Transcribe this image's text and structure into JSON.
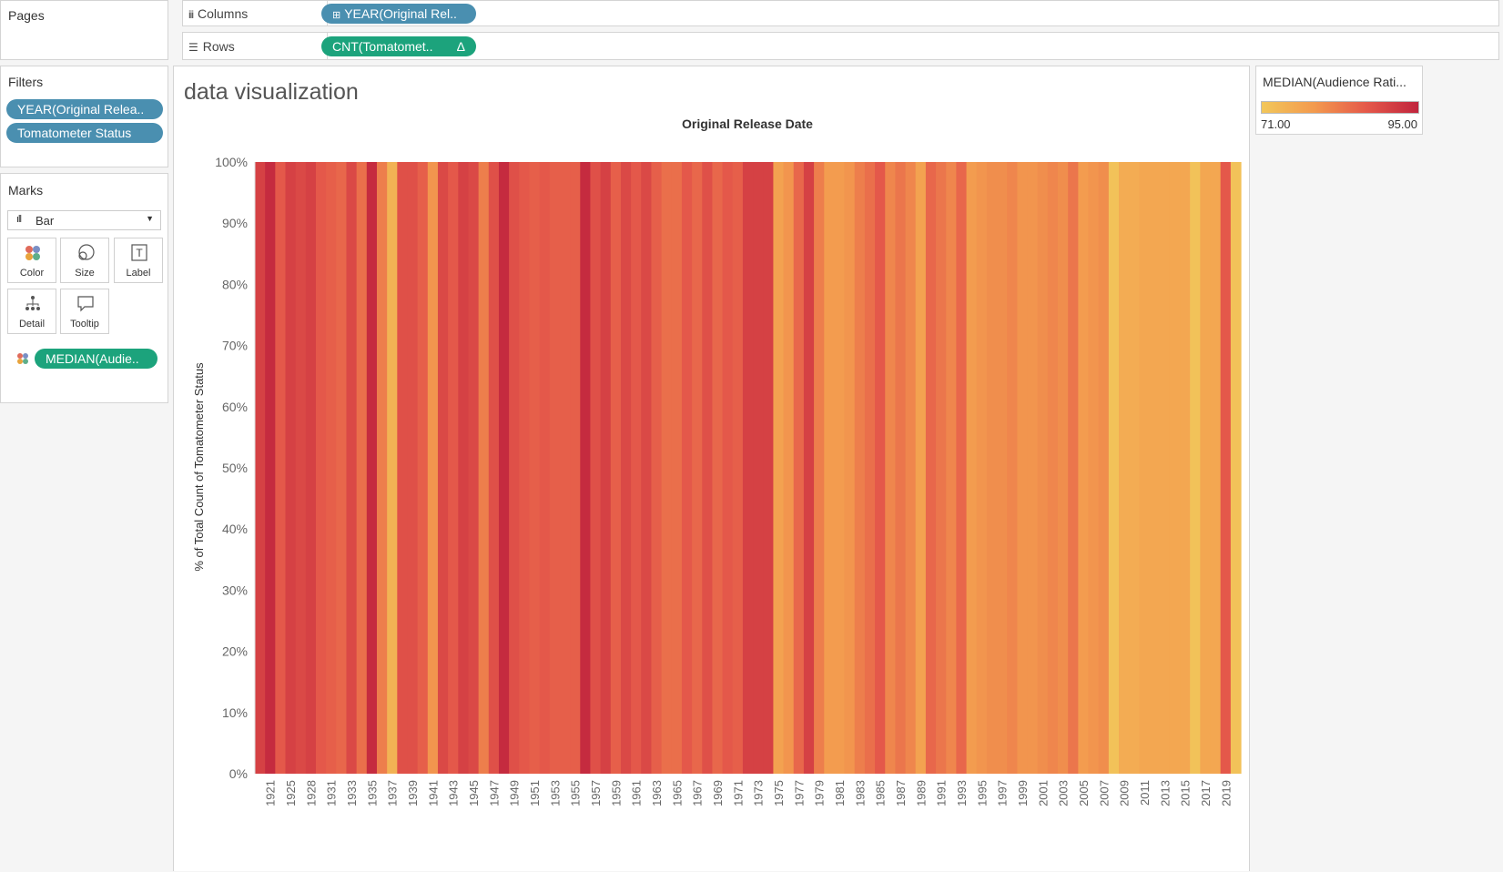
{
  "pages_panel": {
    "title": "Pages"
  },
  "columns_shelf": {
    "label": "Columns",
    "pill": "YEAR(Original Rel.."
  },
  "rows_shelf": {
    "label": "Rows",
    "pill": "CNT(Tomatomet..",
    "pill_delta": "Δ"
  },
  "filters_panel": {
    "title": "Filters",
    "pills": [
      "YEAR(Original Relea..",
      "Tomatometer Status"
    ]
  },
  "marks_panel": {
    "title": "Marks",
    "mark_type": "Bar",
    "buttons": [
      "Color",
      "Size",
      "Label",
      "Detail",
      "Tooltip"
    ],
    "color_pill": "MEDIAN(Audie.."
  },
  "legend": {
    "title": "MEDIAN(Audience Rati...",
    "min_label": "71.00",
    "max_label": "95.00",
    "color_min": "#f2c75a",
    "color_max": "#c0243d"
  },
  "worksheet": {
    "title": "data visualization"
  },
  "chart_data": {
    "type": "bar",
    "title": "Original Release Date",
    "ylabel": "% of Total Count of Tomatometer Status",
    "y_ticks": [
      "100%",
      "90%",
      "80%",
      "70%",
      "60%",
      "50%",
      "40%",
      "30%",
      "20%",
      "10%",
      "0%"
    ],
    "ylim": [
      0,
      100
    ],
    "x_tick_labels": [
      "1921",
      "1925",
      "1928",
      "1931",
      "1933",
      "1935",
      "1937",
      "1939",
      "1941",
      "1943",
      "1945",
      "1947",
      "1949",
      "1951",
      "1953",
      "1955",
      "1957",
      "1959",
      "1961",
      "1963",
      "1965",
      "1967",
      "1969",
      "1971",
      "1973",
      "1975",
      "1977",
      "1979",
      "1981",
      "1983",
      "1985",
      "1987",
      "1989",
      "1991",
      "1993",
      "1995",
      "1997",
      "1999",
      "2001",
      "2003",
      "2005",
      "2007",
      "2009",
      "2011",
      "2013",
      "2015",
      "2017",
      "2019"
    ],
    "categories": [
      "1920",
      "1921",
      "1924",
      "1925",
      "1927",
      "1928",
      "1930",
      "1931",
      "1932",
      "1933",
      "1934",
      "1935",
      "1936",
      "1937",
      "1938",
      "1939",
      "1940",
      "1941",
      "1942",
      "1943",
      "1944",
      "1945",
      "1946",
      "1947",
      "1948",
      "1949",
      "1950",
      "1951",
      "1952",
      "1953",
      "1954",
      "1955",
      "1956",
      "1957",
      "1958",
      "1959",
      "1960",
      "1961",
      "1962",
      "1963",
      "1964",
      "1965",
      "1966",
      "1967",
      "1968",
      "1969",
      "1970",
      "1971",
      "1972",
      "1973",
      "1974",
      "1975",
      "1976",
      "1977",
      "1978",
      "1979",
      "1980",
      "1981",
      "1982",
      "1983",
      "1984",
      "1985",
      "1986",
      "1987",
      "1988",
      "1989",
      "1990",
      "1991",
      "1992",
      "1993",
      "1994",
      "1995",
      "1996",
      "1997",
      "1998",
      "1999",
      "2000",
      "2001",
      "2002",
      "2003",
      "2004",
      "2005",
      "2006",
      "2007",
      "2008",
      "2009",
      "2010",
      "2011",
      "2012",
      "2013",
      "2014",
      "2015",
      "2016",
      "2017",
      "2018",
      "2019",
      "2020"
    ],
    "values": [
      100,
      100,
      100,
      100,
      100,
      100,
      100,
      100,
      100,
      100,
      100,
      100,
      100,
      100,
      100,
      100,
      100,
      100,
      100,
      100,
      100,
      100,
      100,
      100,
      100,
      100,
      100,
      100,
      100,
      100,
      100,
      100,
      100,
      100,
      100,
      100,
      100,
      100,
      100,
      100,
      100,
      100,
      100,
      100,
      100,
      100,
      100,
      100,
      100,
      100,
      100,
      100,
      100,
      100,
      100,
      100,
      100,
      100,
      100,
      100,
      100,
      100,
      100,
      100,
      100,
      100,
      100,
      100,
      100,
      100,
      100,
      100,
      100,
      100,
      100,
      100,
      100,
      100,
      100,
      100,
      100,
      100,
      100,
      100,
      100,
      100,
      100,
      100,
      100,
      100,
      100,
      100,
      100,
      100,
      100,
      100,
      100
    ],
    "color_values": [
      91,
      94,
      88,
      91,
      90,
      91,
      88,
      87,
      86,
      90,
      85,
      94,
      83,
      75,
      89,
      89,
      87,
      80,
      90,
      88,
      91,
      90,
      83,
      89,
      94,
      89,
      88,
      87,
      88,
      87,
      87,
      87,
      94,
      89,
      91,
      87,
      90,
      88,
      90,
      87,
      85,
      85,
      88,
      86,
      89,
      86,
      88,
      87,
      91,
      91,
      91,
      78,
      80,
      86,
      91,
      83,
      79,
      79,
      80,
      83,
      85,
      88,
      82,
      84,
      82,
      78,
      86,
      84,
      82,
      86,
      79,
      80,
      81,
      81,
      82,
      80,
      80,
      81,
      82,
      81,
      84,
      79,
      80,
      81,
      72,
      76,
      76,
      77,
      77,
      77,
      77,
      77,
      72,
      77,
      77,
      88,
      72
    ],
    "color_range": [
      71,
      95
    ],
    "grid": false
  }
}
